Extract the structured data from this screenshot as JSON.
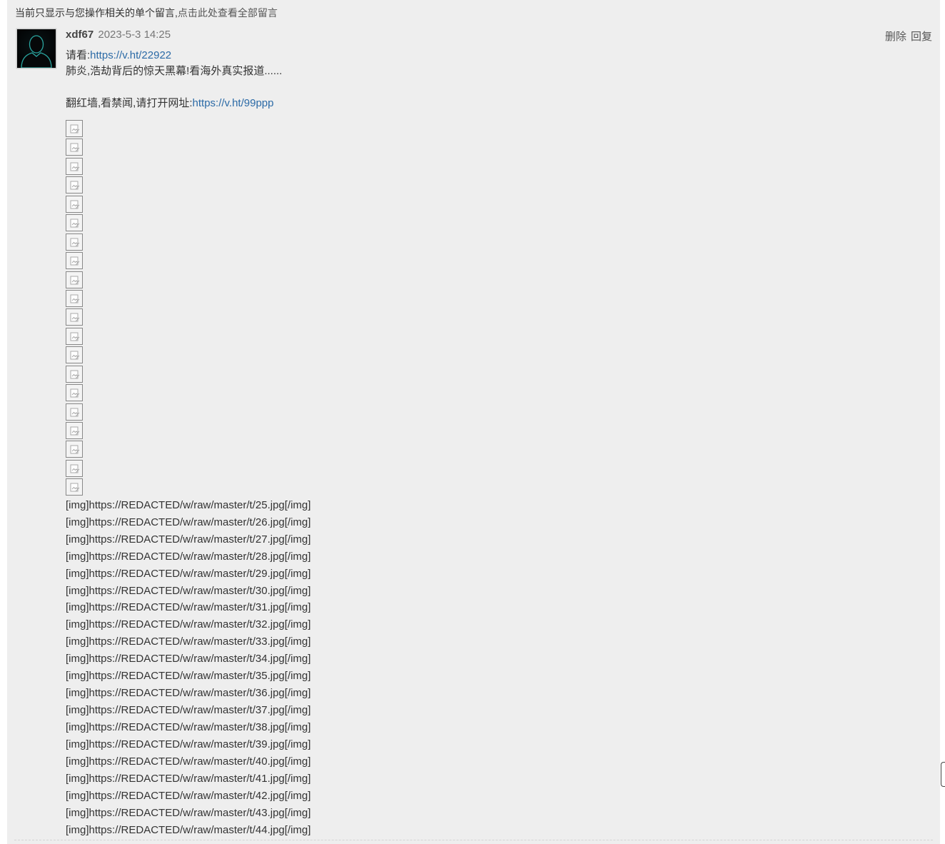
{
  "notice": {
    "text": "当前只显示与您操作相关的单个留言,",
    "link": "点击此处查看全部留言"
  },
  "comment": {
    "author": "xdf67",
    "date": "2023-5-3 14:25",
    "actions": {
      "delete": "删除",
      "reply": "回复"
    },
    "line1_prefix": "请看:",
    "line1_link": "https://v.ht/22922",
    "line2": "肺炎,浩劫背后的惊天黑幕!看海外真实报道......",
    "line3_prefix": "翻红墙,看禁闻,请打开网址:",
    "line3_link": "https://v.ht/99ppp",
    "broken_image_count": 20,
    "bbcode_lines": [
      "[img]https://REDACTED/w/raw/master/t/25.jpg[/img]",
      "[img]https://REDACTED/w/raw/master/t/26.jpg[/img]",
      "[img]https://REDACTED/w/raw/master/t/27.jpg[/img]",
      "[img]https://REDACTED/w/raw/master/t/28.jpg[/img]",
      "[img]https://REDACTED/w/raw/master/t/29.jpg[/img]",
      "[img]https://REDACTED/w/raw/master/t/30.jpg[/img]",
      "[img]https://REDACTED/w/raw/master/t/31.jpg[/img]",
      "[img]https://REDACTED/w/raw/master/t/32.jpg[/img]",
      "[img]https://REDACTED/w/raw/master/t/33.jpg[/img]",
      "[img]https://REDACTED/w/raw/master/t/34.jpg[/img]",
      "[img]https://REDACTED/w/raw/master/t/35.jpg[/img]",
      "[img]https://REDACTED/w/raw/master/t/36.jpg[/img]",
      "[img]https://REDACTED/w/raw/master/t/37.jpg[/img]",
      "[img]https://REDACTED/w/raw/master/t/38.jpg[/img]",
      "[img]https://REDACTED/w/raw/master/t/39.jpg[/img]",
      "[img]https://REDACTED/w/raw/master/t/40.jpg[/img]",
      "[img]https://REDACTED/w/raw/master/t/41.jpg[/img]",
      "[img]https://REDACTED/w/raw/master/t/42.jpg[/img]",
      "[img]https://REDACTED/w/raw/master/t/43.jpg[/img]",
      "[img]https://REDACTED/w/raw/master/t/44.jpg[/img]"
    ]
  },
  "icons": {
    "avatar": "default-user-silhouette-icon",
    "broken_image": "broken-image-icon"
  },
  "colors": {
    "link": "#2b6aa6",
    "panel_bg": "#eeeeee",
    "text": "#333333"
  }
}
